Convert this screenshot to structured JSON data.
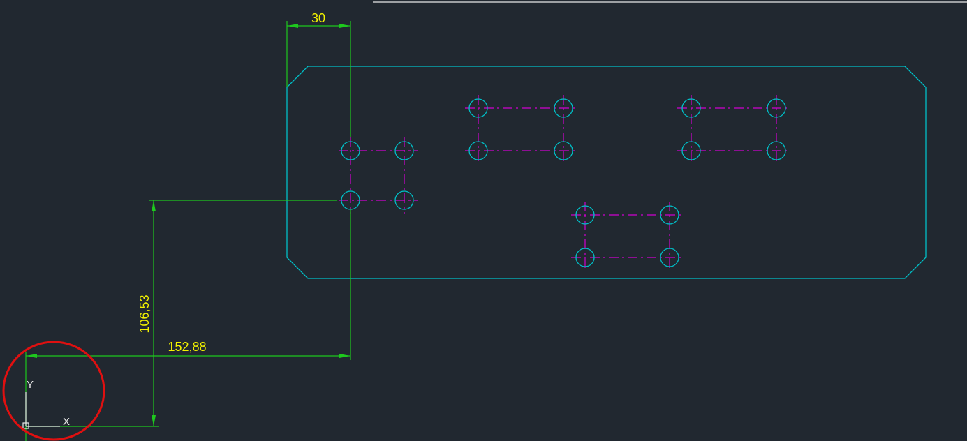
{
  "drawing": {
    "dimensions": {
      "top_width": "30",
      "vertical": "106,53",
      "horizontal": "152,88"
    },
    "ucs": {
      "x_label": "X",
      "y_label": "Y"
    },
    "colors": {
      "background": "#212830",
      "geometry": "#00c0c8",
      "centerlines": "#d000d0",
      "dimension_lines": "#1ec81e",
      "dimension_text": "#f2f200",
      "highlight_circle": "#e01010"
    }
  }
}
